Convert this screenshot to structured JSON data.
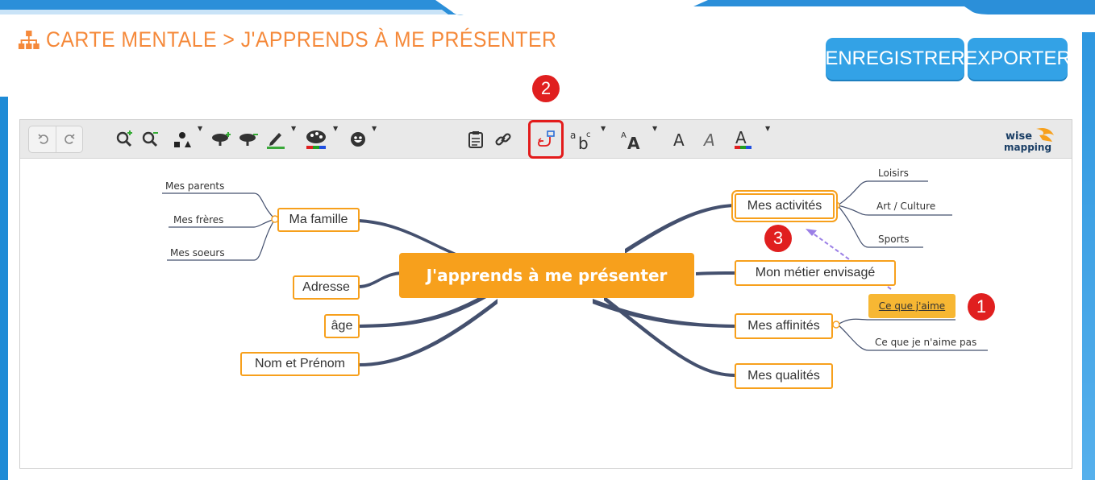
{
  "header": {
    "title": "CARTE MENTALE > J'APPRENDS À ME PRÉSENTER",
    "save_label": "ENREGISTRER",
    "export_label": "EXPORTER"
  },
  "badges": {
    "one": "1",
    "two": "2",
    "three": "3"
  },
  "toolbar": {
    "items": [
      "undo-icon",
      "redo-icon",
      "zoom-in-icon",
      "zoom-out-icon",
      "shape-icon",
      "add-topic-icon",
      "delete-topic-icon",
      "border-color-icon",
      "background-color-icon",
      "emoji-icon",
      "note-icon",
      "link-icon",
      "relationship-icon",
      "text-size-icon",
      "font-icon",
      "bold-icon",
      "italic-icon",
      "font-color-icon"
    ],
    "logo_line1": "wise",
    "logo_line2": "mapping"
  },
  "mindmap": {
    "central": "J'apprends à me présenter",
    "left": {
      "famille": "Ma famille",
      "adresse": "Adresse",
      "age": "âge",
      "nom": "Nom et Prénom",
      "famille_children": [
        "Mes parents",
        "Mes frères",
        "Mes soeurs"
      ]
    },
    "right": {
      "activites": "Mes activités",
      "metier": "Mon métier envisagé",
      "affinites": "Mes affinités",
      "qualites": "Mes qualités",
      "activites_children": [
        "Loisirs",
        "Art / Culture",
        "Sports"
      ],
      "affinites_children": [
        "Ce que j'aime",
        "Ce que je n'aime pas"
      ]
    }
  },
  "colors": {
    "accent_orange": "#f7a01c",
    "title_orange": "#f5893a",
    "button_blue": "#33a2e6",
    "badge_red": "#e01f1f",
    "connector_navy": "#44506e",
    "relation_purple": "#9b7fe6"
  }
}
